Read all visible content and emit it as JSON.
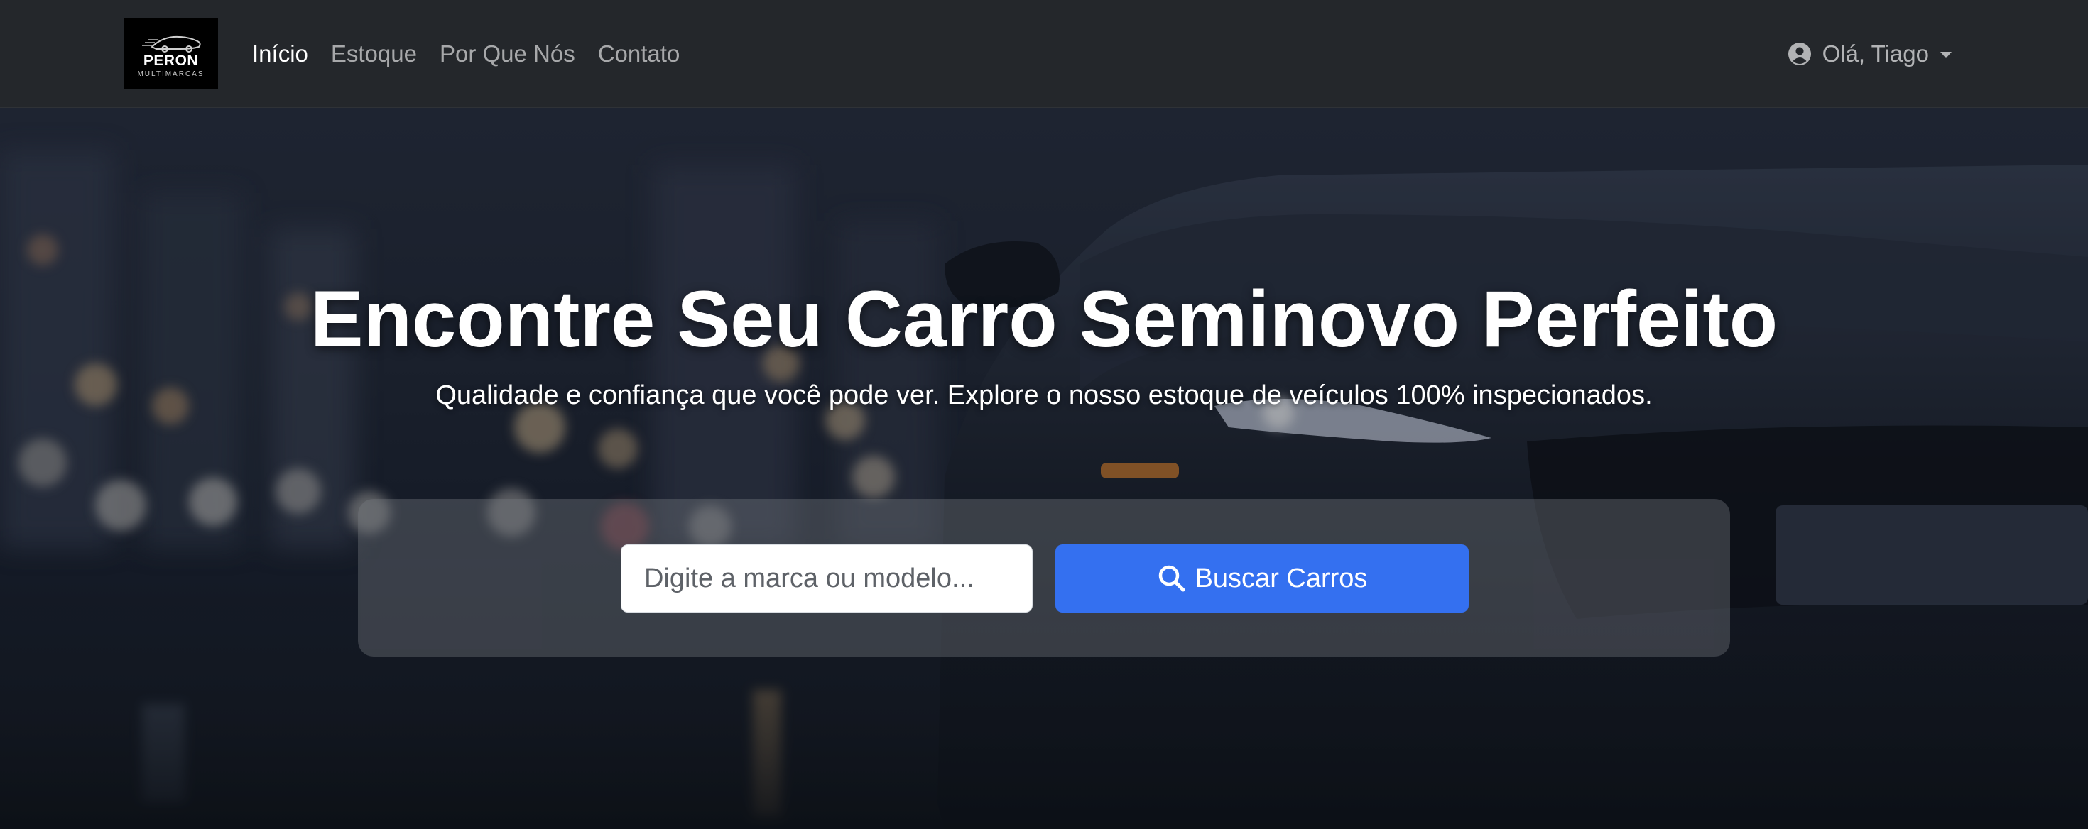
{
  "brand": {
    "name": "PERON",
    "subtitle": "MULTIMARCAS",
    "logo_icon": "car-silhouette-icon"
  },
  "nav": {
    "items": [
      {
        "label": "Início",
        "active": true
      },
      {
        "label": "Estoque",
        "active": false
      },
      {
        "label": "Por Que Nós",
        "active": false
      },
      {
        "label": "Contato",
        "active": false
      }
    ]
  },
  "user_menu": {
    "label": "Olá, Tiago",
    "icon": "user-circle-icon",
    "dropdown_icon": "caret-down-icon"
  },
  "hero": {
    "title": "Encontre Seu Carro Seminovo Perfeito",
    "subtitle": "Qualidade e confiança que você pode ver. Explore o nosso estoque de veículos 100% inspecionados."
  },
  "search": {
    "placeholder": "Digite a marca ou modelo...",
    "value": "",
    "button_label": "Buscar Carros",
    "button_icon": "search-icon"
  },
  "colors": {
    "navbar_bg": "#24272b",
    "accent": "#3470f0",
    "nav_active": "#ffffff",
    "nav_inactive": "rgba(255,255,255,0.60)"
  }
}
